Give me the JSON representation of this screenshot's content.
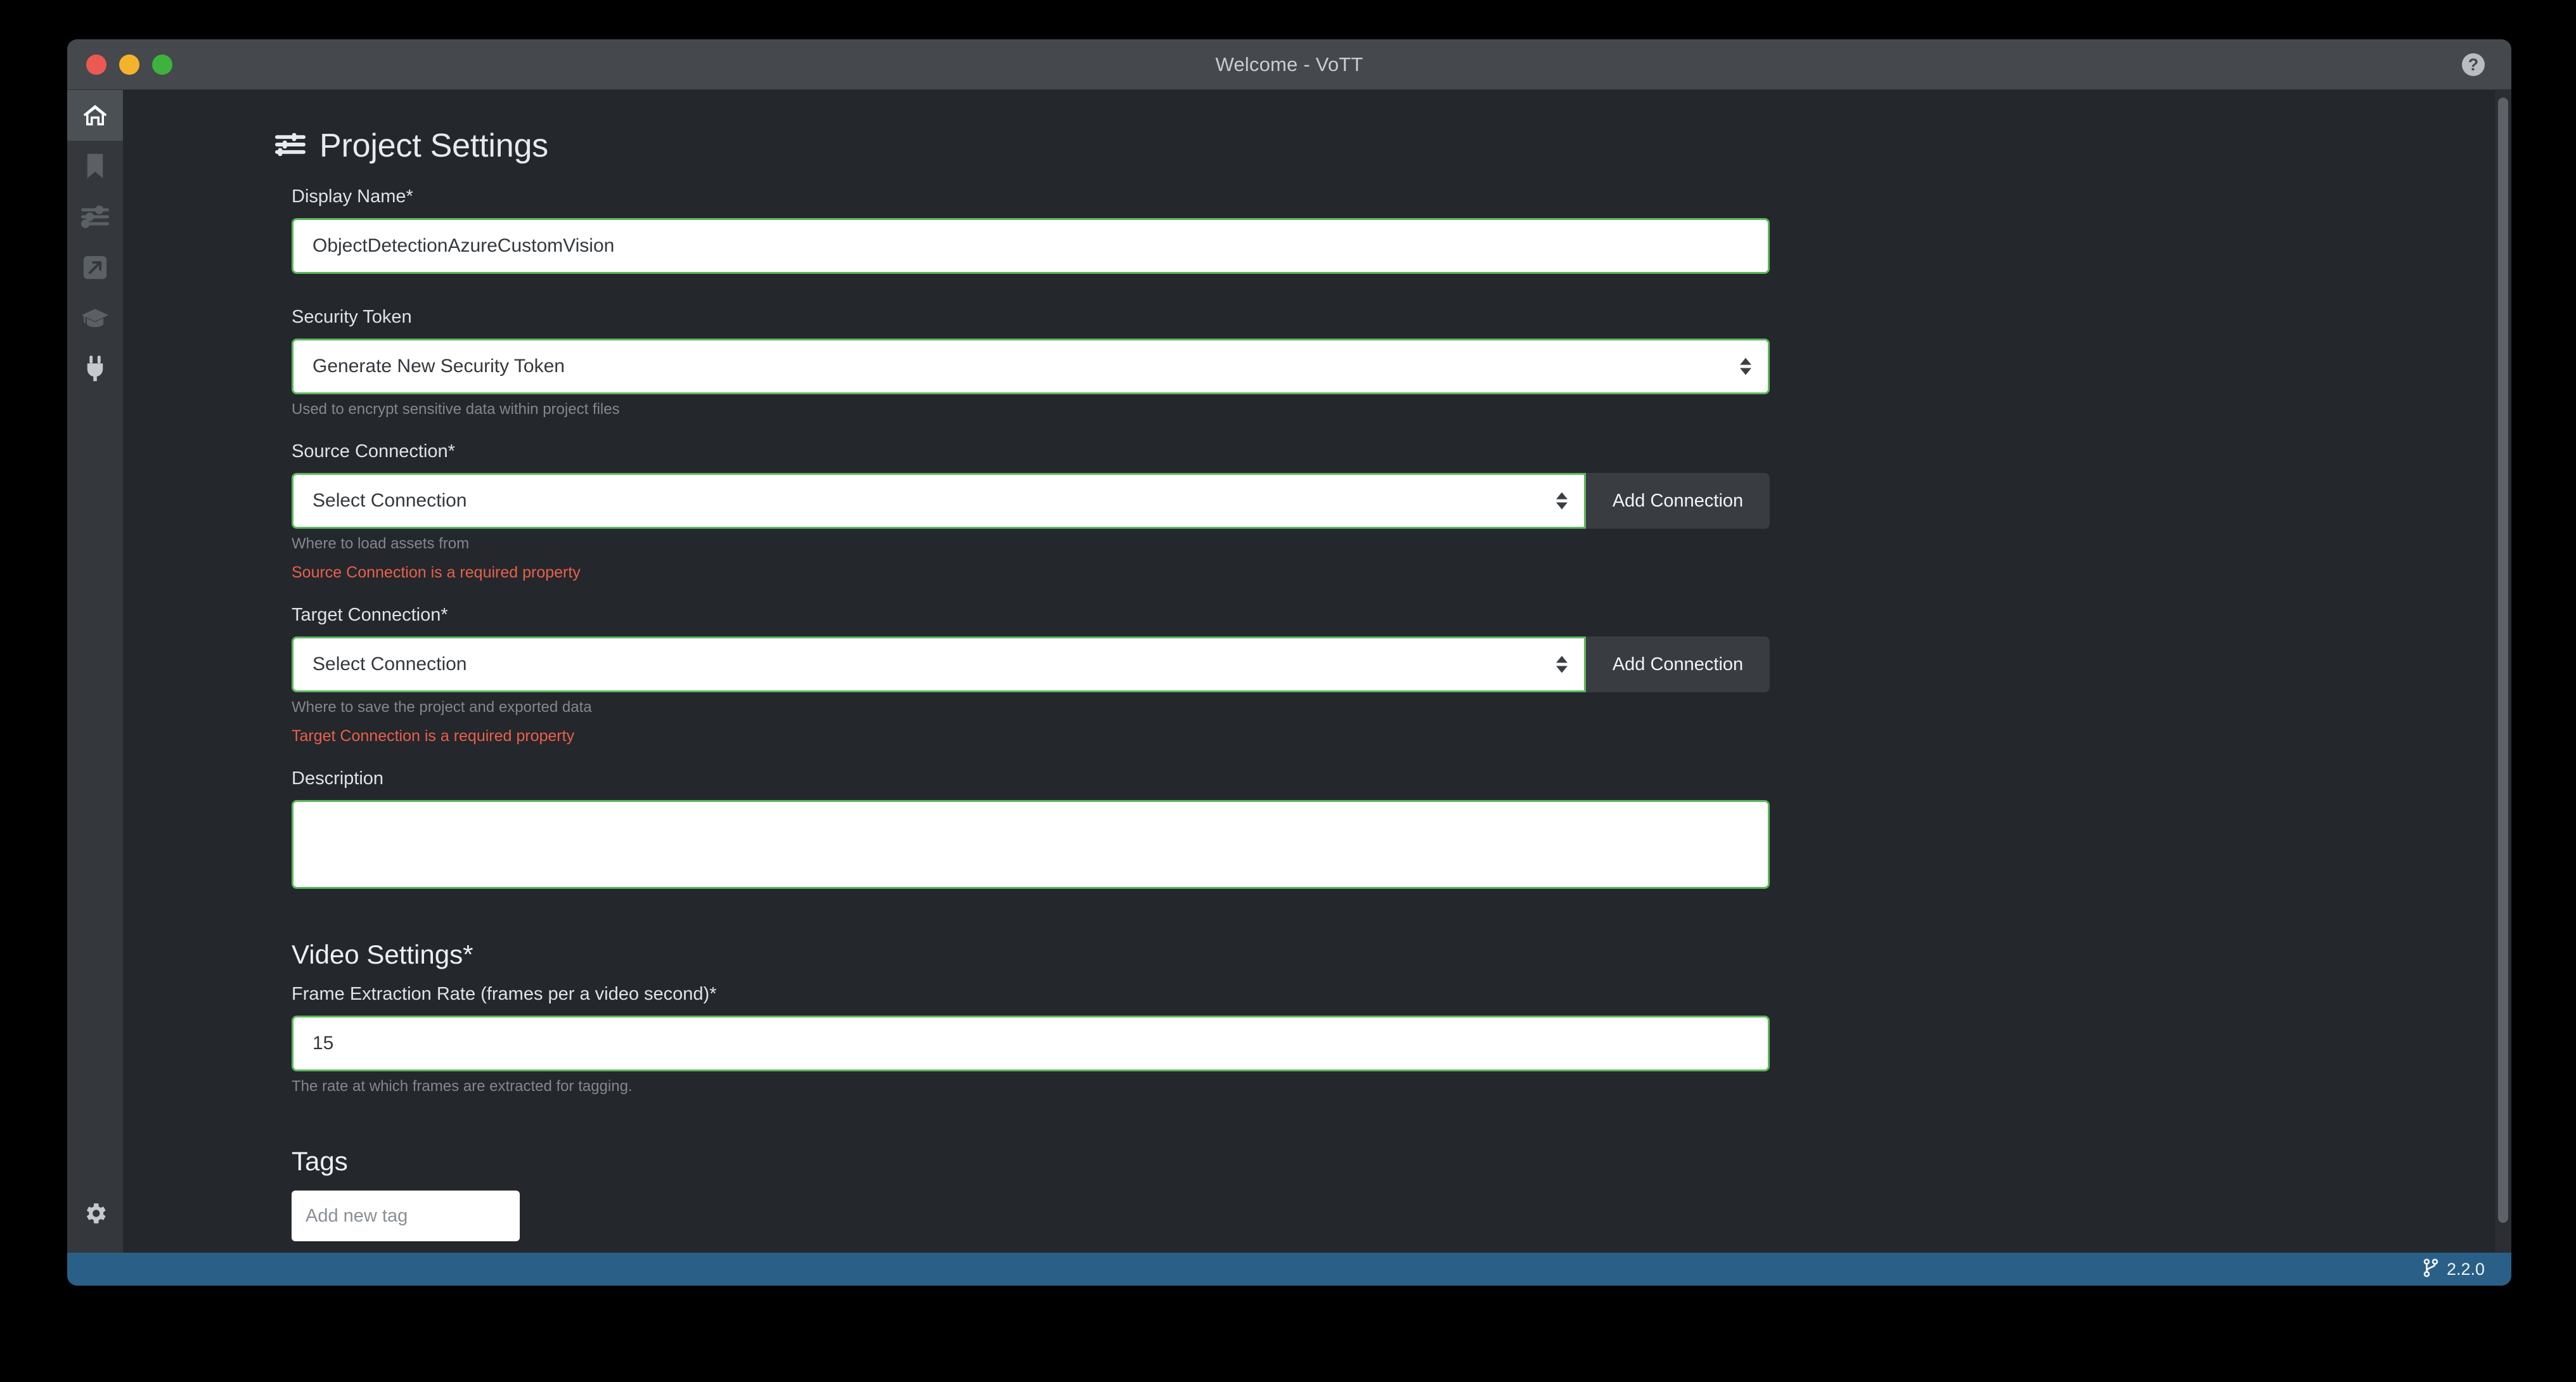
{
  "window": {
    "title": "Welcome - VoTT",
    "help_icon": "question-circle-icon",
    "traffic_lights": [
      {
        "name": "close",
        "color": "#eb5a52"
      },
      {
        "name": "minimize",
        "color": "#f5b32c"
      },
      {
        "name": "maximize",
        "color": "#3db33d"
      }
    ]
  },
  "sidebar": {
    "items": [
      {
        "name": "home",
        "icon": "home-icon",
        "active": true
      },
      {
        "name": "recent-projects",
        "icon": "bookmark-icon",
        "active": false
      },
      {
        "name": "project-settings",
        "icon": "sliders-icon",
        "active": false
      },
      {
        "name": "export",
        "icon": "export-arrow-icon",
        "active": false
      },
      {
        "name": "training",
        "icon": "graduation-cap-icon",
        "active": false
      },
      {
        "name": "connections",
        "icon": "plug-icon",
        "active": false
      }
    ],
    "bottom": {
      "name": "app-settings",
      "icon": "gear-icon"
    }
  },
  "page": {
    "title": "Project Settings",
    "title_icon": "sliders-icon"
  },
  "form": {
    "display_name": {
      "label": "Display Name*",
      "value": "ObjectDetectionAzureCustomVision",
      "placeholder": ""
    },
    "security_token": {
      "label": "Security Token",
      "value": "Generate New Security Token",
      "help": "Used to encrypt sensitive data within project files"
    },
    "source_connection": {
      "label": "Source Connection*",
      "value": "Select Connection",
      "help": "Where to load assets from",
      "error": "Source Connection is a required property",
      "button_label": "Add Connection"
    },
    "target_connection": {
      "label": "Target Connection*",
      "value": "Select Connection",
      "help": "Where to save the project and exported data",
      "error": "Target Connection is a required property",
      "button_label": "Add Connection"
    },
    "description": {
      "label": "Description",
      "value": "",
      "placeholder": ""
    },
    "video_settings": {
      "section_title": "Video Settings*",
      "frame_rate": {
        "label": "Frame Extraction Rate (frames per a video second)*",
        "value": "15",
        "help": "The rate at which frames are extracted for tagging."
      }
    },
    "tags": {
      "section_title": "Tags",
      "add_tag_placeholder": "Add new tag"
    }
  },
  "status_bar": {
    "icon": "git-branch-icon",
    "version": "2.2.0",
    "background": "#2a6087"
  },
  "colors": {
    "app_background": "#24272b",
    "titlebar": "#45484c",
    "sidebar": "#34383c",
    "sidebar_active": "#4b5055",
    "valid_border": "#5cb85c",
    "error_text": "#e8604c",
    "help_text": "#83888e",
    "button_dark": "#393d42"
  }
}
